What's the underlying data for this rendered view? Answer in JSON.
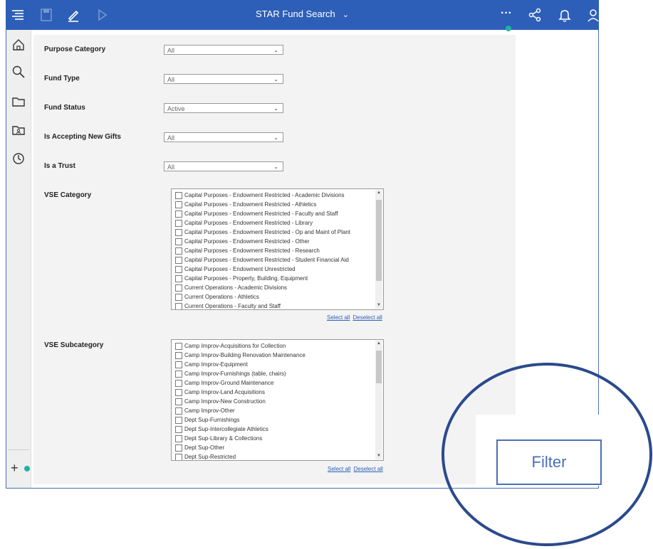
{
  "header": {
    "title": "STAR Fund Search",
    "more_label": "···"
  },
  "filters": [
    {
      "label": "Purpose Category",
      "value": "All"
    },
    {
      "label": "Fund Type",
      "value": "All"
    },
    {
      "label": "Fund Status",
      "value": "Active"
    },
    {
      "label": "Is Accepting New Gifts",
      "value": "All"
    },
    {
      "label": "Is a Trust",
      "value": "All"
    }
  ],
  "vse_category": {
    "label": "VSE Category",
    "items": [
      "Capital Purposes - Endowment Restricted - Academic Divisions",
      "Capital Purposes - Endowment Restricted - Athletics",
      "Capital Purposes - Endowment Restricted - Faculty and Staff",
      "Capital Purposes - Endowment Restricted - Library",
      "Capital Purposes - Endowment Restricted - Op and Maint of Plant",
      "Capital Purposes - Endowment Restricted - Other",
      "Capital Purposes - Endowment Restricted - Research",
      "Capital Purposes - Endowment Restricted - Student Financial Aid",
      "Capital Purposes - Endowment Unrestricted",
      "Capital Purposes - Property, Building, Equipment",
      "Current Operations - Academic Divisions",
      "Current Operations - Athletics",
      "Current Operations - Faculty and Staff"
    ],
    "select_all": "Select all",
    "deselect_all": "Deselect all"
  },
  "vse_subcategory": {
    "label": "VSE Subcategory",
    "items": [
      "Camp Improv-Acquisitions for Collection",
      "Camp Improv-Building Renovation Maintenance",
      "Camp Improv-Equipment",
      "Camp Improv-Furnishings (table, chairs)",
      "Camp Improv-Ground Maintenance",
      "Camp Improv-Land Acquisitions",
      "Camp Improv-New Construction",
      "Camp Improv-Other",
      "Dept Sup-Furnishings",
      "Dept Sup-Intercollegiate Athletics",
      "Dept Sup-Library & Collections",
      "Dept Sup-Other",
      "Dept Sup-Restricted"
    ],
    "select_all": "Select all",
    "deselect_all": "Deselect all"
  },
  "filter_button": {
    "label": "Filter"
  }
}
